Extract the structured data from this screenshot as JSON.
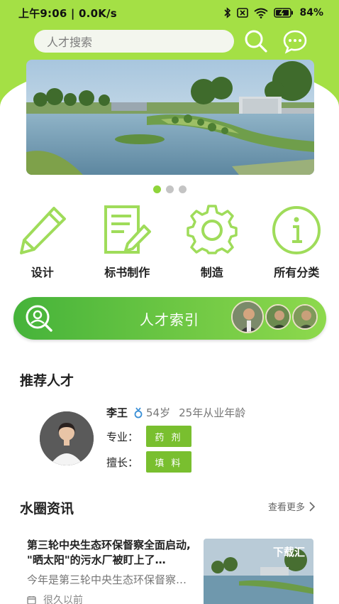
{
  "status_bar": {
    "time_speed": "上午9:06 | 0.0K/s",
    "battery": "84%"
  },
  "search": {
    "placeholder": "人才搜索"
  },
  "banner": {
    "dots": 3,
    "active_dot": 1
  },
  "categories": [
    {
      "label": "设计",
      "icon": "pencil-icon"
    },
    {
      "label": "标书制作",
      "icon": "document-edit-icon"
    },
    {
      "label": "制造",
      "icon": "gear-icon"
    },
    {
      "label": "所有分类",
      "icon": "info-icon"
    }
  ],
  "talent_index": {
    "title": "人才索引"
  },
  "recommended": {
    "section_title": "推荐人才",
    "name": "李王",
    "age": "54岁",
    "experience": "25年从业年龄",
    "major_label": "专业：",
    "major_value": "药 剂",
    "skill_label": "擅长：",
    "skill_value": "填 料"
  },
  "news": {
    "section_title": "水圈资讯",
    "more_label": "查看更多",
    "item": {
      "title": "第三轮中央生态环保督察全面启动, \"晒太阳\"的污水厂被盯上了…",
      "desc": "今年是第三轮中央生态环保督察…",
      "time": "很久以前",
      "image_label": "下载汇"
    }
  },
  "colors": {
    "brand_green": "#a4e045",
    "accent_green": "#79bf2f",
    "icon_green": "#9fdc5a"
  }
}
